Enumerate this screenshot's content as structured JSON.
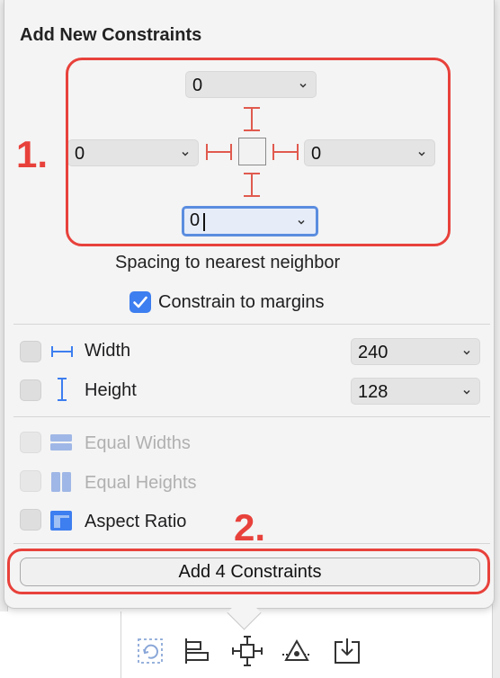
{
  "popover": {
    "title": "Add New Constraints",
    "spacing": {
      "top": "0",
      "left": "0",
      "right": "0",
      "bottom": "0",
      "caption": "Spacing to nearest neighbor"
    },
    "constrain_to_margins": {
      "label": "Constrain to margins",
      "checked": true
    },
    "size_rows": [
      {
        "label": "Width",
        "value": "240",
        "checked": false,
        "icon": "width-icon"
      },
      {
        "label": "Height",
        "value": "128",
        "checked": false,
        "icon": "height-icon"
      }
    ],
    "equal_rows": [
      {
        "label": "Equal Widths",
        "enabled": false,
        "icon": "equal-widths-icon"
      },
      {
        "label": "Equal Heights",
        "enabled": false,
        "icon": "equal-heights-icon"
      },
      {
        "label": "Aspect Ratio",
        "enabled": true,
        "icon": "aspect-ratio-icon"
      }
    ],
    "add_button_label": "Add 4 Constraints"
  },
  "annotations": {
    "step1": "1.",
    "step2": "2."
  },
  "toolbar": {
    "icons": [
      "update-frames-icon",
      "align-icon",
      "add-constraints-icon",
      "resolve-issues-icon",
      "embed-in-icon"
    ]
  },
  "colors": {
    "accent": "#3d7ef0",
    "annotation_red": "#e8413b",
    "constraint_red": "#e05a4e"
  }
}
